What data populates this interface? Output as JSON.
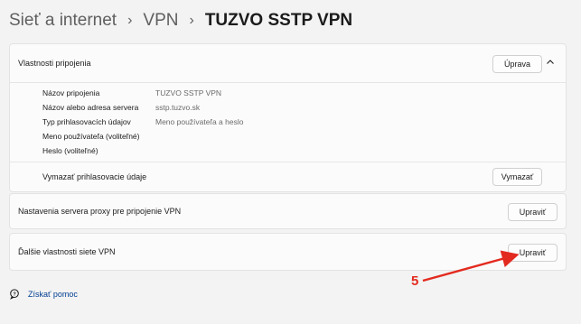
{
  "breadcrumb": {
    "item1": "Sieť a internet",
    "item2": "VPN",
    "current": "TUZVO SSTP VPN",
    "separator": "›"
  },
  "connection_properties": {
    "title": "Vlastnosti pripojenia",
    "edit_button": "Úprava",
    "collapse_icon": "chevron-up-icon",
    "rows": [
      {
        "label": "Názov pripojenia",
        "value": "TUZVO SSTP VPN"
      },
      {
        "label": "Názov alebo adresa servera",
        "value": "sstp.tuzvo.sk"
      },
      {
        "label": "Typ prihlasovacích údajov",
        "value": "Meno používateľa a heslo"
      },
      {
        "label": "Meno používateľa (voliteľné)",
        "value": ""
      },
      {
        "label": "Heslo (voliteľné)",
        "value": ""
      }
    ],
    "clear_label": "Vymazať prihlasovacie údaje",
    "clear_button": "Vymazať"
  },
  "proxy": {
    "label": "Nastavenia servera proxy pre pripojenie VPN",
    "button": "Upraviť"
  },
  "more_vpn": {
    "label": "Ďalšie vlastnosti siete VPN",
    "button": "Upraviť"
  },
  "help": {
    "icon": "help-icon",
    "label": "Získať pomoc"
  },
  "annotation": {
    "number": "5",
    "color": "#e32a1f"
  }
}
